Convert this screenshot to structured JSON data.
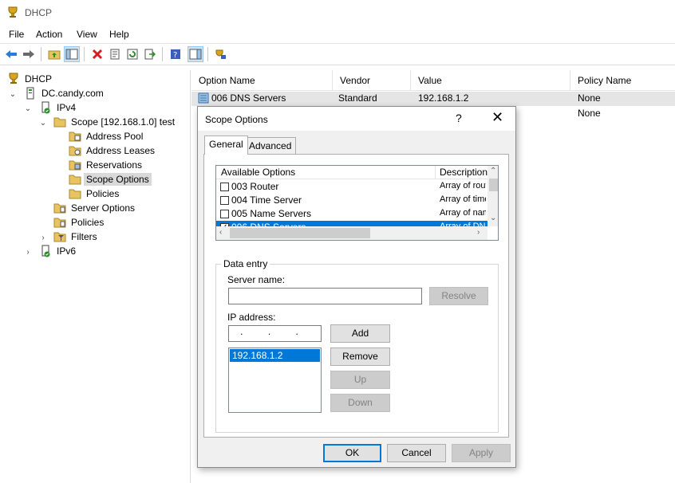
{
  "window": {
    "title": "DHCP"
  },
  "menu": [
    "File",
    "Action",
    "View",
    "Help"
  ],
  "tree": {
    "root": "DHCP",
    "server": "DC.candy.com",
    "ipv4": "IPv4",
    "scope": "Scope [192.168.1.0] test",
    "scope_children": [
      "Address Pool",
      "Address Leases",
      "Reservations",
      "Scope Options",
      "Policies"
    ],
    "server_options": "Server Options",
    "policies": "Policies",
    "filters": "Filters",
    "ipv6": "IPv6"
  },
  "list": {
    "columns": [
      "Option Name",
      "Vendor",
      "Value",
      "Policy Name"
    ],
    "rows": [
      {
        "name": "006 DNS Servers",
        "vendor": "Standard",
        "value": "192.168.1.2",
        "policy": "None"
      },
      {
        "name": "",
        "vendor": "",
        "value": "",
        "policy": "None"
      }
    ]
  },
  "dialog": {
    "title": "Scope Options",
    "help": "?",
    "close": "✕",
    "tabs": [
      "General",
      "Advanced"
    ],
    "options_header": [
      "Available Options",
      "Description"
    ],
    "options": [
      {
        "name": "003 Router",
        "desc": "Array of router",
        "checked": false
      },
      {
        "name": "004 Time Server",
        "desc": "Array of time",
        "checked": false
      },
      {
        "name": "005 Name Servers",
        "desc": "Array of name",
        "checked": false
      },
      {
        "name": "006 DNS Servers",
        "desc": "Array of DNS",
        "checked": true
      }
    ],
    "data_entry": {
      "legend": "Data entry",
      "server_name_label": "Server name:",
      "server_name_value": "",
      "resolve": "Resolve",
      "ip_label": "IP address:",
      "ip_value": ". . .",
      "add": "Add",
      "remove": "Remove",
      "up": "Up",
      "down": "Down",
      "ip_list": [
        "192.168.1.2"
      ]
    },
    "buttons": {
      "ok": "OK",
      "cancel": "Cancel",
      "apply": "Apply"
    }
  },
  "colors": {
    "selection": "#0078d7",
    "tree_selected": "#d9d9d9",
    "dialog_bg": "#f0f0f0"
  }
}
